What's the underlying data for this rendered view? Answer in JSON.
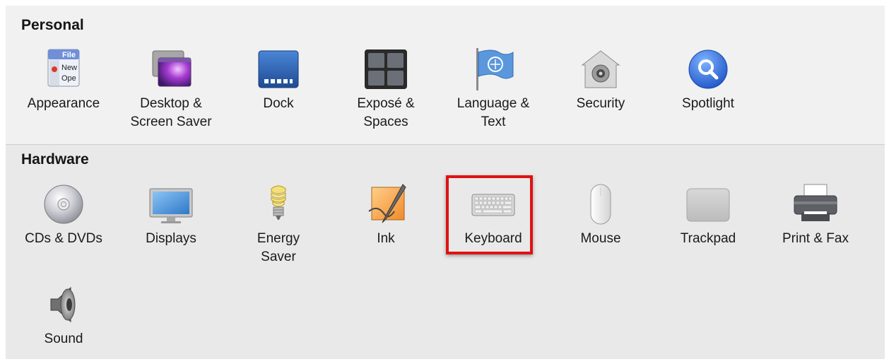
{
  "personal": {
    "title": "Personal",
    "panes": [
      {
        "label": "Appearance",
        "icon": "appearance-icon"
      },
      {
        "label": "Desktop &\nScreen Saver",
        "icon": "desktop-screensaver-icon"
      },
      {
        "label": "Dock",
        "icon": "dock-icon"
      },
      {
        "label": "Exposé &\nSpaces",
        "icon": "expose-spaces-icon"
      },
      {
        "label": "Language &\nText",
        "icon": "language-text-icon"
      },
      {
        "label": "Security",
        "icon": "security-icon"
      },
      {
        "label": "Spotlight",
        "icon": "spotlight-icon"
      }
    ],
    "appearance_icon_text": [
      "File",
      "New",
      "Ope"
    ]
  },
  "hardware": {
    "title": "Hardware",
    "panes": [
      {
        "label": "CDs & DVDs",
        "icon": "cd-dvd-icon"
      },
      {
        "label": "Displays",
        "icon": "displays-icon"
      },
      {
        "label": "Energy\nSaver",
        "icon": "energy-saver-icon"
      },
      {
        "label": "Ink",
        "icon": "ink-icon"
      },
      {
        "label": "Keyboard",
        "icon": "keyboard-icon"
      },
      {
        "label": "Mouse",
        "icon": "mouse-icon"
      },
      {
        "label": "Trackpad",
        "icon": "trackpad-icon"
      },
      {
        "label": "Print & Fax",
        "icon": "printer-icon"
      },
      {
        "label": "Sound",
        "icon": "speaker-icon"
      }
    ]
  },
  "highlighted_pane": "Keyboard",
  "colors": {
    "highlight_border": "#e01212",
    "spotlight_blue": "#1f6fe0"
  }
}
